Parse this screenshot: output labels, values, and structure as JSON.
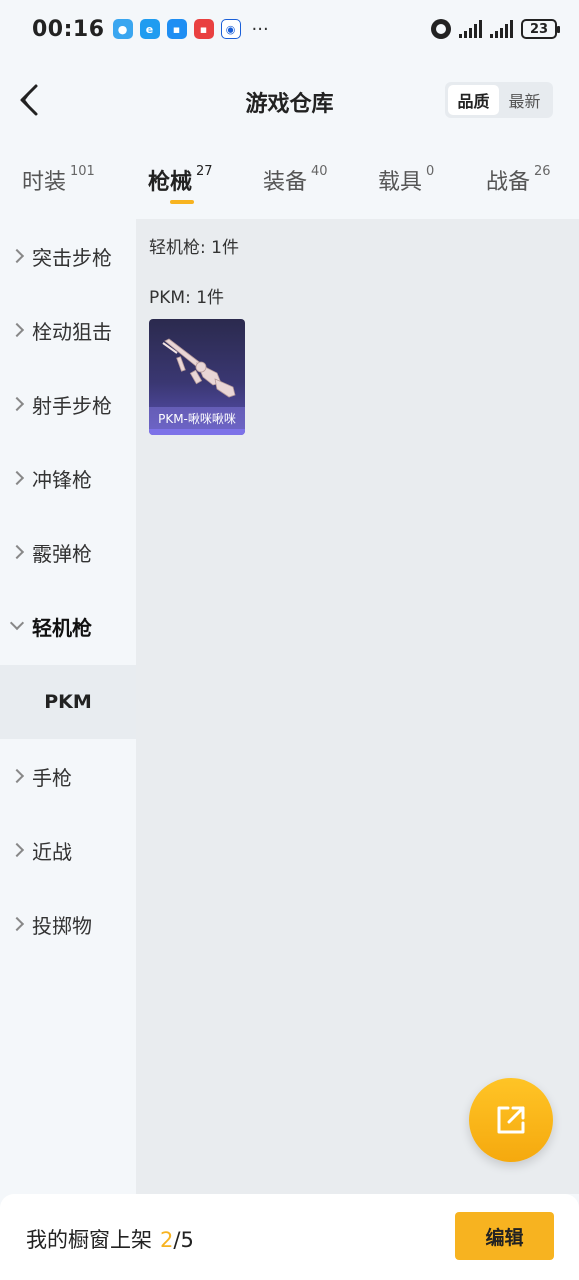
{
  "status_bar": {
    "time": "00:16",
    "battery": "23",
    "more": "···"
  },
  "header": {
    "title": "游戏仓库",
    "sort_options": [
      "品质",
      "最新"
    ],
    "active_sort": "品质"
  },
  "tabs": [
    {
      "label": "时装",
      "count": "101"
    },
    {
      "label": "枪械",
      "count": "27"
    },
    {
      "label": "装备",
      "count": "40"
    },
    {
      "label": "载具",
      "count": "0"
    },
    {
      "label": "战备",
      "count": "26"
    }
  ],
  "active_tab": "枪械",
  "sidebar": {
    "items": [
      {
        "label": "突击步枪"
      },
      {
        "label": "栓动狙击"
      },
      {
        "label": "射手步枪"
      },
      {
        "label": "冲锋枪"
      },
      {
        "label": "霰弹枪"
      },
      {
        "label": "轻机枪"
      },
      {
        "label": "手枪"
      },
      {
        "label": "近战"
      },
      {
        "label": "投掷物"
      }
    ],
    "expanded": "轻机枪",
    "sub_item": "PKM"
  },
  "content": {
    "category_title": "轻机枪: 1件",
    "group_title": "PKM: 1件",
    "items": [
      {
        "name": "PKM-啾咪啾咪"
      }
    ]
  },
  "bottom_bar": {
    "label": "我的橱窗上架",
    "count": "2",
    "separator": "/",
    "total": "5",
    "edit_label": "编辑"
  },
  "colors": {
    "accent": "#f7b320",
    "background": "#f4f7fa",
    "content_bg": "#e9ecef"
  }
}
